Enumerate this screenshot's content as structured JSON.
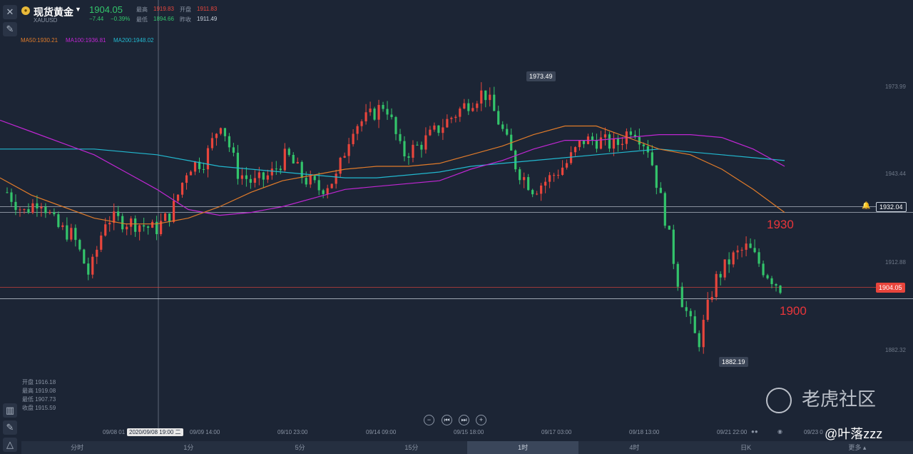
{
  "header": {
    "name": "现货黄金",
    "symbol": "XAUUSD",
    "price": "1904.05",
    "change": "−7.44",
    "change_pct": "−0.39%",
    "high_label": "最高",
    "high": "1919.83",
    "open_label": "开盘",
    "open": "1911.83",
    "low_label": "最低",
    "low": "1894.66",
    "prev_close_label": "昨收",
    "prev_close": "1911.49"
  },
  "moving_averages": {
    "ma50": "MA50:1930.21",
    "ma100": "MA100:1936.81",
    "ma200": "MA200:1948.02"
  },
  "colors": {
    "background": "#1c2535",
    "up": "#e8453c",
    "down": "#33c46b",
    "ma50": "#e07b2a",
    "ma100": "#c026d3",
    "ma200": "#22b8cf",
    "annotation": "#e8353a"
  },
  "y_axis": [
    "1973.99",
    "1943.44",
    "1912.88",
    "1882.32"
  ],
  "price_tags": {
    "line_1932": "1932.04",
    "current": "1904.05",
    "high_marker": "1973.49",
    "low_marker": "1882.19"
  },
  "crosshair": {
    "time": "2020/09/08 19:00 二"
  },
  "x_axis": [
    "09/08 01",
    "09/09 14:00",
    "09/10 23:00",
    "09/14 09:00",
    "09/15 18:00",
    "09/17 03:00",
    "09/18 13:00",
    "09/21 22:00",
    "09/23 0"
  ],
  "annotations": {
    "level_high": "1930",
    "level_low": "1900"
  },
  "ohlc_panel": {
    "open": "开盘 1916.18",
    "high": "最高 1919.08",
    "low": "最低 1907.73",
    "close": "收盘 1915.59"
  },
  "nav_buttons": [
    "−",
    "⏮",
    "⏭",
    "+"
  ],
  "tabs": [
    "分时",
    "1分",
    "5分",
    "15分",
    "1时",
    "4时",
    "日K",
    "更多 ▴"
  ],
  "active_tab": "1时",
  "watermark": "老虎社区",
  "author": "@叶落zzz",
  "icons": {
    "close": "close-icon",
    "draw": "pen-icon",
    "alert": "bell-icon",
    "indicators": "bar-chart-icon",
    "settings": "ruler-icon"
  },
  "chart_data": {
    "type": "candlestick",
    "title": "",
    "xlabel": "",
    "ylabel": "",
    "ylim": [
      1870,
      1990
    ],
    "x": [
      "09/08 01",
      "09/09 14:00",
      "09/10 23:00",
      "09/14 09:00",
      "09/15 18:00",
      "09/17 03:00",
      "09/18 13:00",
      "09/21 22:00",
      "09/23 0"
    ],
    "close_path": [
      1937,
      1930,
      1935,
      1925,
      1922,
      1908,
      1928,
      1927,
      1926,
      1924,
      1930,
      1946,
      1948,
      1962,
      1944,
      1940,
      1943,
      1950,
      1942,
      1938,
      1942,
      1960,
      1963,
      1968,
      1950,
      1953,
      1958,
      1963,
      1968,
      1972,
      1960,
      1945,
      1938,
      1942,
      1947,
      1955,
      1955,
      1953,
      1960,
      1952,
      1928,
      1900,
      1884,
      1906,
      1914,
      1918,
      1910,
      1904
    ],
    "ma50": [
      1942,
      1936,
      1932,
      1928,
      1926,
      1926,
      1928,
      1932,
      1937,
      1941,
      1943,
      1945,
      1946,
      1946,
      1947,
      1950,
      1953,
      1957,
      1960,
      1960,
      1956,
      1952,
      1950,
      1945,
      1938,
      1930
    ],
    "ma100": [
      1962,
      1958,
      1954,
      1950,
      1944,
      1938,
      1931,
      1929,
      1930,
      1932,
      1935,
      1938,
      1939,
      1940,
      1941,
      1945,
      1948,
      1952,
      1955,
      1955,
      1956,
      1957,
      1957,
      1956,
      1952,
      1946
    ],
    "ma200": [
      1952,
      1952,
      1952,
      1952,
      1951,
      1950,
      1948,
      1946,
      1945,
      1944,
      1943,
      1942,
      1942,
      1943,
      1944,
      1946,
      1947,
      1948,
      1949,
      1950,
      1951,
      1952,
      1951,
      1950,
      1949,
      1948
    ],
    "horizontal_lines": [
      1932.04,
      1930,
      1904.05,
      1900
    ]
  }
}
